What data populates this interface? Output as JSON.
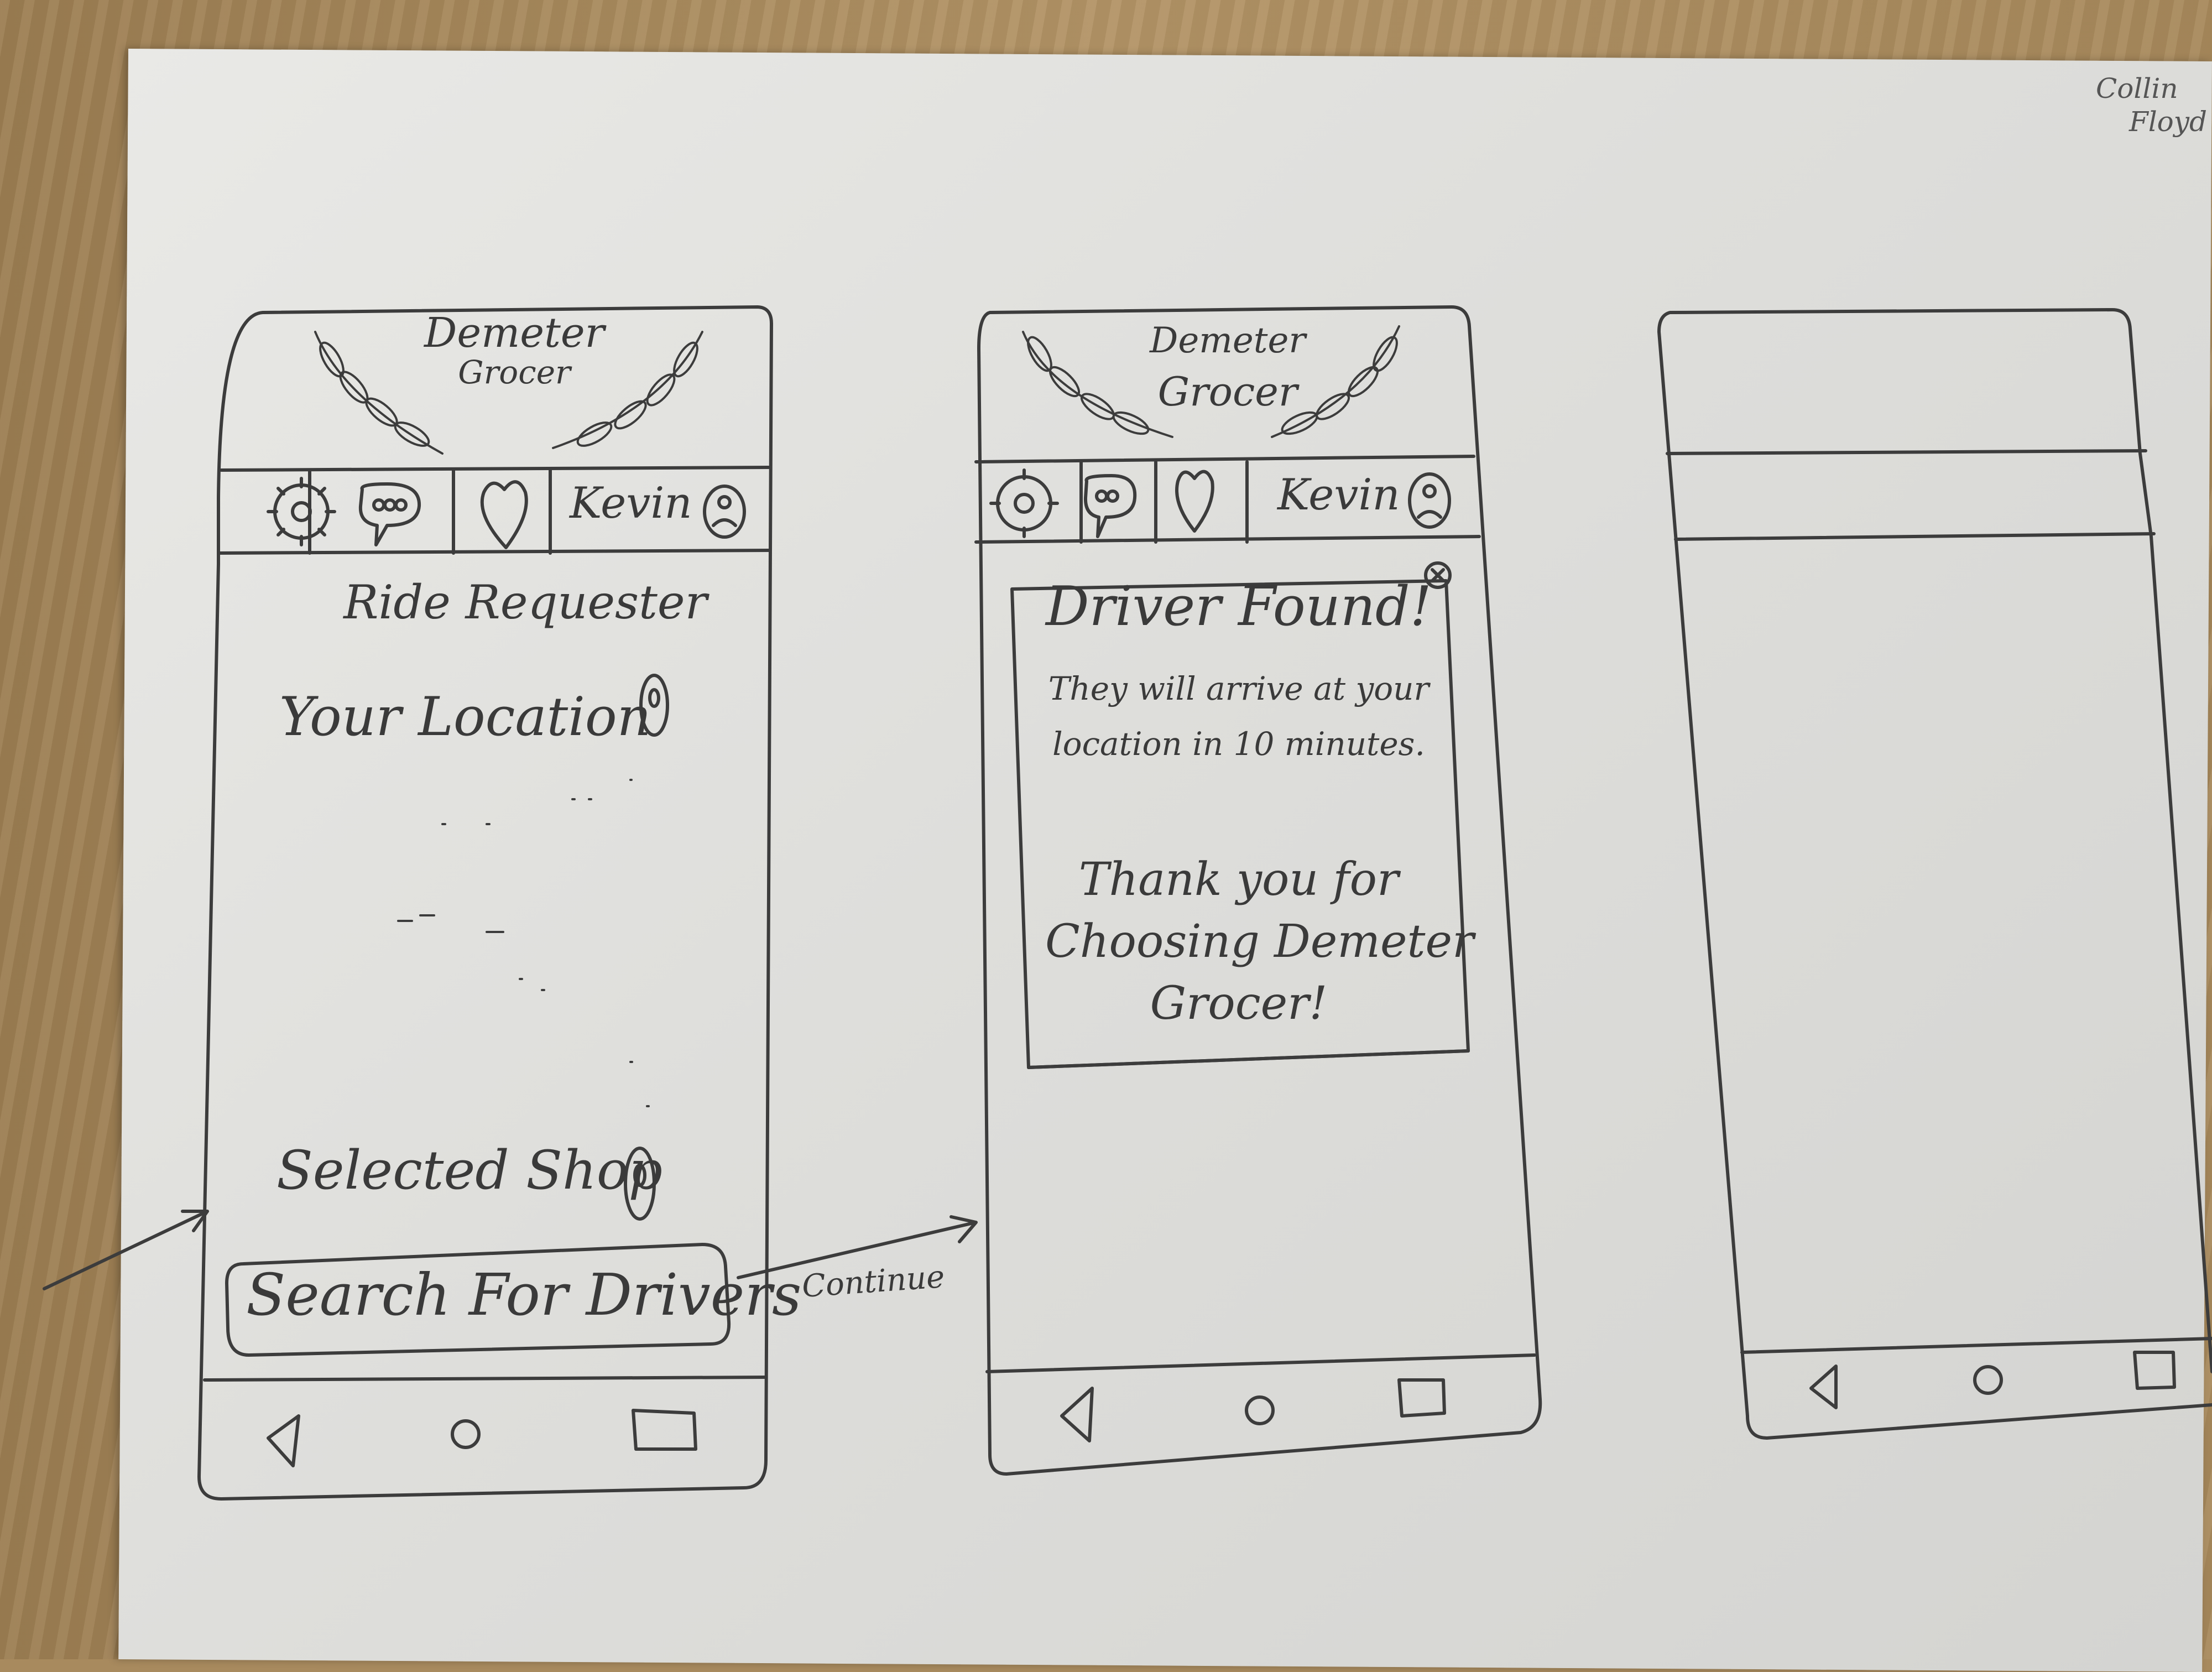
{
  "author_name": [
    "Collin",
    "Floyd"
  ],
  "screens": [
    {
      "app_title": [
        "Demeter",
        "Grocer"
      ],
      "nav": {
        "icons": [
          "settings-gear-icon",
          "chat-bubble-icon",
          "heart-icon",
          "profile-icon"
        ],
        "user_name": "Kevin"
      },
      "screen_title": "Ride Requester",
      "your_location_label": "Your Location",
      "selected_shop_label": "Selected Shop",
      "primary_button": "Search For Drivers",
      "system_nav": [
        "back-triangle-icon",
        "home-circle-icon",
        "recents-square-icon"
      ]
    },
    {
      "app_title": [
        "Demeter",
        "Grocer"
      ],
      "nav": {
        "icons": [
          "settings-gear-icon",
          "chat-bubble-icon",
          "heart-icon",
          "profile-icon"
        ],
        "user_name": "Kevin"
      },
      "dialog": {
        "title": "Driver Found!",
        "message_lines": [
          "They will arrive at your",
          "location in 10 minutes."
        ],
        "thanks_lines": [
          "Thank you for",
          "Choosing Demeter",
          "Grocer!"
        ],
        "close_icon": "close-x-icon"
      },
      "system_nav": [
        "back-triangle-icon",
        "home-circle-icon",
        "recents-square-icon"
      ]
    },
    {
      "blank": true,
      "system_nav": [
        "back-triangle-icon",
        "home-circle-icon",
        "recents-square-icon"
      ]
    }
  ],
  "flow_arrow_label": "Continue",
  "colors": {
    "pencil": "#3a3a3a",
    "paper": "#e4e4e1",
    "desk": "#a88a5e"
  }
}
